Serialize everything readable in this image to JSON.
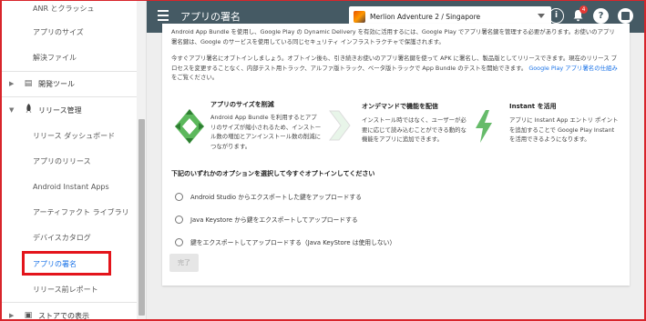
{
  "sidebar": {
    "items": [
      {
        "label": "ANR とクラッシュ"
      },
      {
        "label": "アプリのサイズ"
      },
      {
        "label": "解決ファイル"
      },
      {
        "label": "開発ツール"
      },
      {
        "label": "リリース管理"
      },
      {
        "label": "リリース ダッシュボード"
      },
      {
        "label": "アプリのリリース"
      },
      {
        "label": "Android Instant Apps"
      },
      {
        "label": "アーティファクト ライブラリ"
      },
      {
        "label": "デバイスカタログ"
      },
      {
        "label": "アプリの署名"
      },
      {
        "label": "リリース前レポート"
      },
      {
        "label": "ストアでの表示"
      }
    ]
  },
  "topbar": {
    "title": "アプリの署名",
    "app_name": "Merlion Adventure 2 / Singapore",
    "notification_count": "4",
    "info_glyph": "i",
    "help_glyph": "?"
  },
  "main": {
    "intro_cut": "Android App Bundle を使用し、Google Play の Dynamic Delivery を有効に活用するには、Google Play でアプリ署名鍵を管理する必要があります。お使いのアプリ署名鍵は、Google のサービスを使用している同じセキュリティ インフラストラクチャで保護されます。",
    "intro_text": "今すぐアプリ署名にオプトインしましょう。オプトイン後も、引き続きお使いのアプリ署名鍵を使って APK に署名し、製品版としてリリースできます。現在のリリース プロセスを変更することなく、内部テスト用トラック、アルファ版トラック、ベータ版トラックで App Bundle のテストを開始できます。",
    "intro_link": "Google Play アプリ署名の仕組み",
    "intro_suffix": "をご覧ください。",
    "features": [
      {
        "title": "アプリのサイズを削減",
        "desc": "Android App Bundle を利用するとアプリのサイズが縮小されるため、インストール数の増加とアンインストール数の削減につながります。"
      },
      {
        "title": "オンデマンドで機能を配信",
        "desc": "インストール時ではなく、ユーザーが必要に応じて読み込むことができる動的な機能をアプリに追加できます。"
      },
      {
        "title": "Instant を活用",
        "desc": "アプリに Instant App エントリ ポイントを追加することで Google Play Instant を活用できるようになります。"
      }
    ],
    "options_title": "下記のいずれかのオプションを選択して今すぐオプトインしてください",
    "options": [
      {
        "label": "Android Studio からエクスポートした鍵をアップロードする"
      },
      {
        "label": "Java Keystore から鍵をエクスポートしてアップロードする"
      },
      {
        "label": "鍵をエクスポートしてアップロードする（Java KeyStore は使用しない）"
      }
    ],
    "done_label": "完了"
  }
}
